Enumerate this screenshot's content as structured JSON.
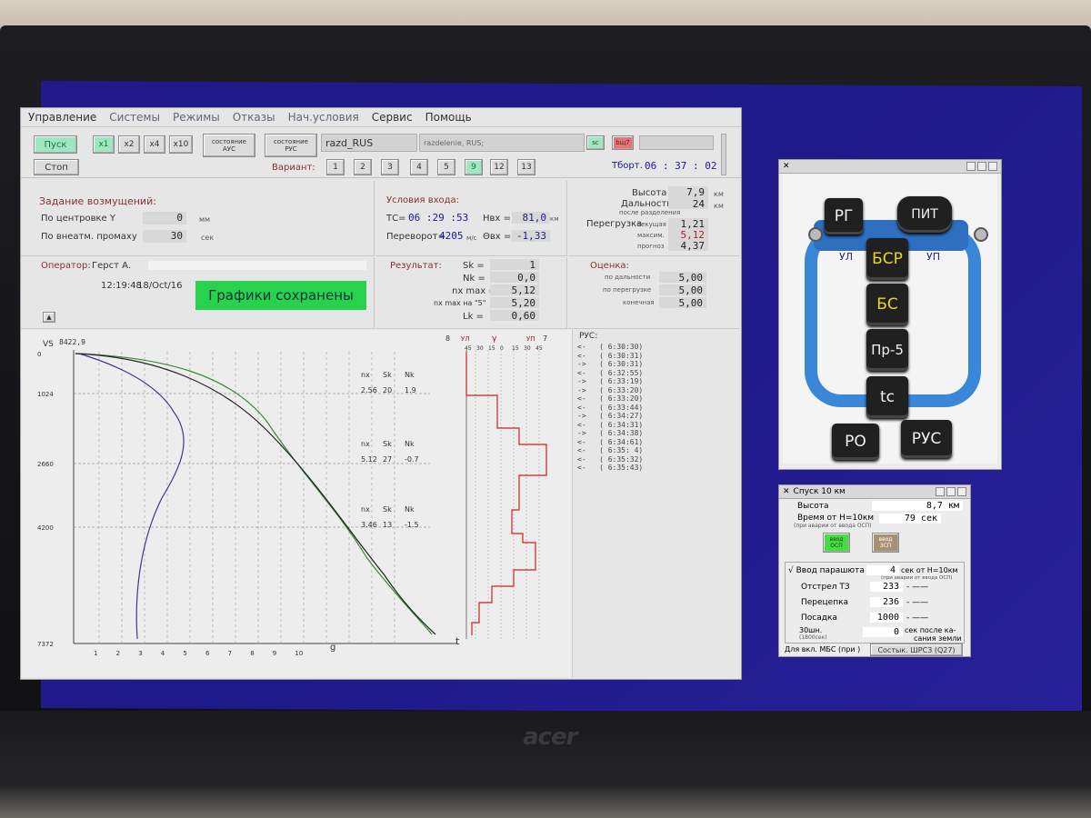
{
  "monitor": {
    "brand": "acer"
  },
  "menu": [
    "Управление",
    "Системы",
    "Режимы",
    "Отказы",
    "Нач.условия",
    "Сервис",
    "Помощь"
  ],
  "toolbar": {
    "start": "Пуск",
    "stop": "Стоп",
    "speeds": [
      "x1",
      "x2",
      "x4",
      "x10"
    ],
    "state_ays_1": "состояние",
    "state_ays_2": "АУС",
    "state_rus_1": "состояние",
    "state_rus_2": "РУС",
    "scenario": "razd_RUS",
    "scenario_desc": "razdelenie, RUS;",
    "tag_sc": "sc",
    "tag_bf": "bщ7",
    "variant_label": "Вариант:",
    "variants": [
      "1",
      "2",
      "3",
      "4",
      "5",
      "9",
      "12",
      "13"
    ],
    "variant_active": "9",
    "tbort_label": "Тборт.",
    "tbort_value": "06 : 37 : 02"
  },
  "disturb": {
    "title": "Задание возмущений:",
    "centering_label": "По центровке  Y",
    "centering_value": "0",
    "centering_unit": "мм",
    "miss_label": "По внеатм.  промаху",
    "miss_value": "30",
    "miss_unit": "сек"
  },
  "entry": {
    "title": "Условия входа:",
    "tc_label": "ТС=",
    "tc_value": "06 :29 :53",
    "h_label": "Нвх =",
    "h_value": "81,0",
    "h_unit": "км",
    "turn_label": "Переворот=",
    "turn_value": "4205",
    "turn_unit": "м/с",
    "theta_label": "Θвх =",
    "theta_value": "-1,33"
  },
  "stats": {
    "height_label": "Высота",
    "height_value": "7,9",
    "height_unit": "км",
    "range_label": "Дальность",
    "range_value": "24",
    "range_unit": "км",
    "after_sep": "после разделения",
    "overload_label": "Перегрузка",
    "current_label": "текущая",
    "current_value": "1,21",
    "max_label": "максим.",
    "max_value": "5,12",
    "forecast_label": "прогноз",
    "forecast_value": "4,37"
  },
  "operator": {
    "label": "Оператор:",
    "name": "Герст А.",
    "time": "12:19:48",
    "date": "18/Oct/16",
    "banner": "Графики сохранены"
  },
  "result": {
    "title": "Результат:",
    "sk_label": "Sk =",
    "sk_value": "1",
    "nk_label": "Nk =",
    "nk_value": "0,0",
    "nxmax_label": "nx max =",
    "nxmax_value": "5,12",
    "nx5_label": "nx max на \"5\"",
    "nx5_value": "5,20",
    "lk_label": "Lk =",
    "lk_value": "0,60"
  },
  "score": {
    "title": "Оценка:",
    "dist_label": "по дальности",
    "dist_value": "5,00",
    "over_label": "по перегрузке",
    "over_value": "5,00",
    "final_label": "конечная",
    "final_value": "5,00"
  },
  "plot": {
    "vs_label": "VS",
    "vs_value": "8422,9",
    "y_ticks": [
      "0",
      "1024",
      "2660",
      "4200",
      "7372"
    ],
    "x_ticks": [
      "1",
      "2",
      "3",
      "4",
      "5",
      "6",
      "7",
      "8",
      "9",
      "10"
    ],
    "x_label": "g",
    "t_label": "t",
    "annotations": [
      {
        "h1": "nx",
        "h2": "Sk",
        "h3": "Nk",
        "v1": "2.56",
        "v2": "20",
        "v3": "1.9"
      },
      {
        "h1": "nx",
        "h2": "Sk",
        "h3": "Nk",
        "v1": "5.12",
        "v2": "27",
        "v3": "-0.7"
      },
      {
        "h1": "nx",
        "h2": "Sk",
        "h3": "Nk",
        "v1": "3.46",
        "v2": "13",
        "v3": "-1.5"
      }
    ],
    "gamma_left_num": "8",
    "gamma_left": "УЛ",
    "gamma_sym": "γ",
    "gamma_right": "УП",
    "gamma_right_num": "7",
    "gamma_ticks": [
      "45",
      "30",
      "15",
      "0",
      "15",
      "30",
      "45"
    ]
  },
  "rus": {
    "title": "РУС:",
    "events": [
      "<-   ( 6:30:30)",
      "<-   ( 6:30:31)",
      "->   ( 6:30:31)",
      "<-   ( 6:32:55)",
      "->   ( 6:33:19)",
      "->   ( 6:33:20)",
      "<-   ( 6:33:20)",
      "<-   ( 6:33:44)",
      "->   ( 6:34:27)",
      "<-   ( 6:34:31)",
      "->   ( 6:34:38)",
      "<-   ( 6:34:61)",
      "<-   ( 6:35: 4)",
      "<-   ( 6:35:32)",
      "<-   ( 6:35:43)"
    ]
  },
  "joystick": {
    "keys": {
      "rg": "РГ",
      "pit": "ПИТ",
      "bsr": "БСР",
      "bs": "БС",
      "pr5": "Пр-5",
      "tc": "tc",
      "ro": "РО",
      "rus": "РУС"
    },
    "ul": "УЛ",
    "up": "УП"
  },
  "descent": {
    "title": "Спуск 10 км",
    "height_label": "Высота",
    "height_value": "8,7 км",
    "time_label": "Время от Н=10км",
    "time_sub": "(при аварии от ввода ОСП)",
    "time_value": "79 сек",
    "btn_osp_1": "ввод",
    "btn_osp_2": "ОСП",
    "btn_zsp_1": "ввод",
    "btn_zsp_2": "ЗСП",
    "chute_label": "Ввод парашюта",
    "chute_value": "4",
    "chute_suffix": "сек от Н=10км",
    "chute_sub": "(при аварии от ввода ОСП)",
    "tz_label": "Отстрел ТЗ",
    "tz_value": "233",
    "recouple_label": "Перецепка",
    "recouple_value": "236",
    "land_label": "Посадка",
    "land_value": "1000",
    "z30_label": "30шн.",
    "z30_sub": "(1800сек)",
    "z30_value": "0",
    "z30_suffix": "сек после ка-",
    "z30_suffix2": "сания земли",
    "mbs_label": "Для вкл. МБС (при )",
    "shrs_label": "Состык. ШРС3 (Q27)"
  }
}
